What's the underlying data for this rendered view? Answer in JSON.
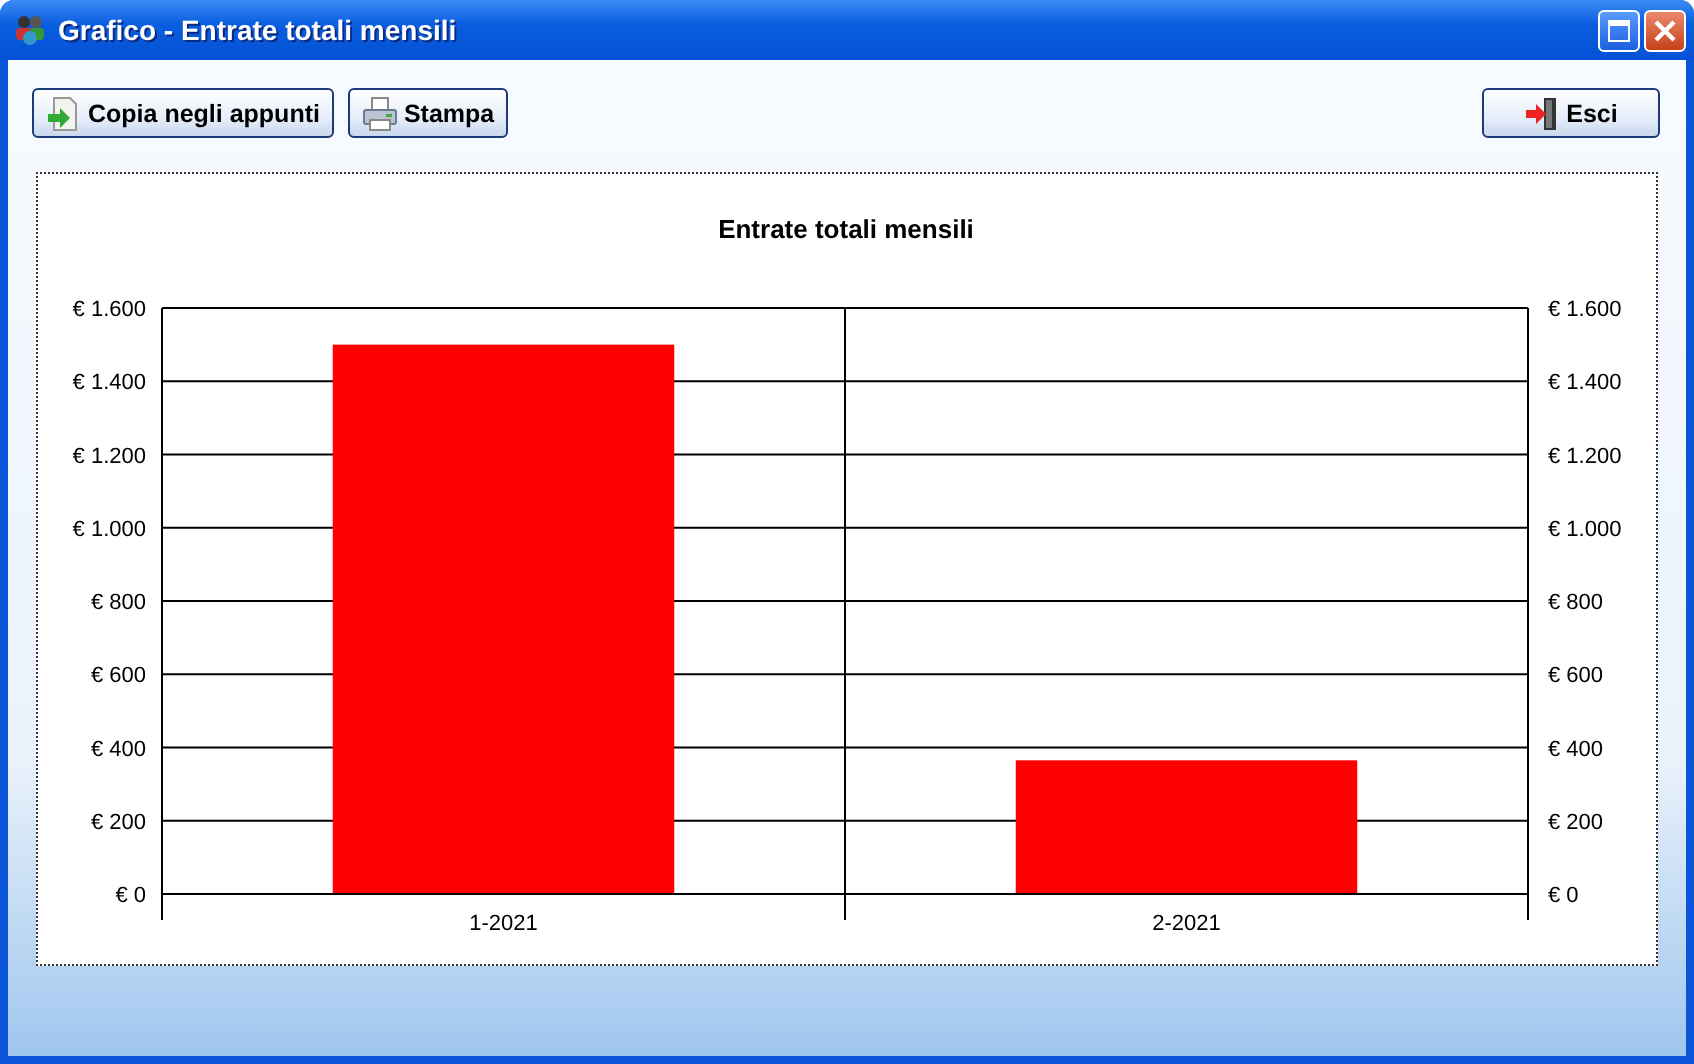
{
  "window": {
    "title": "Grafico - Entrate totali mensili",
    "controls": [
      {
        "kind": "maximize"
      },
      {
        "kind": "close"
      }
    ]
  },
  "toolbar": {
    "left_buttons": [
      {
        "label": "Copia negli appunti",
        "kind": "copy"
      },
      {
        "label": "Stampa",
        "kind": "print"
      }
    ],
    "right_buttons": [
      {
        "label": "Esci",
        "kind": "exit"
      }
    ]
  },
  "chart": {
    "chart_data": {
      "type": "bar",
      "title": "Entrate totali mensili",
      "categories": [
        "1-2021",
        "2-2021"
      ],
      "series": [
        {
          "color": "#ff0000",
          "values": [
            1500,
            365
          ]
        }
      ],
      "grid": true,
      "ylim": [
        0,
        1600
      ],
      "yticks": [
        {
          "value": 0,
          "label": "€ 0"
        },
        {
          "value": 200,
          "label": "€ 200"
        },
        {
          "value": 400,
          "label": "€ 400"
        },
        {
          "value": 600,
          "label": "€ 600"
        },
        {
          "value": 800,
          "label": "€ 800"
        },
        {
          "value": 1000,
          "label": "€ 1.000"
        },
        {
          "value": 1200,
          "label": "€ 1.200"
        },
        {
          "value": 1400,
          "label": "€ 1.400"
        },
        {
          "value": 1600,
          "label": "€ 1.600"
        }
      ]
    }
  }
}
